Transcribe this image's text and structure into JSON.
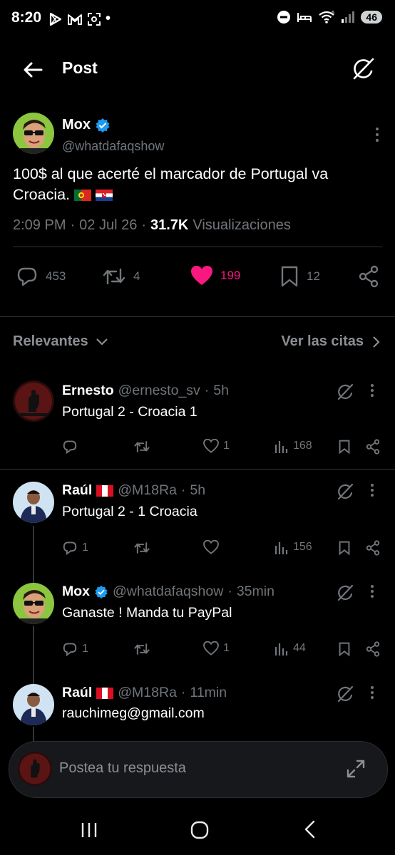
{
  "status_bar": {
    "time": "8:20",
    "battery": "46",
    "dot": "•"
  },
  "header": {
    "title": "Post"
  },
  "post": {
    "author": {
      "name": "Mox",
      "handle": "@whatdafaqshow",
      "verified": true
    },
    "text": "100$ al que acerté el marcador de Portugal va Croacia.",
    "flags": [
      "portugal-flag",
      "croatia-flag"
    ],
    "time": "2:09 PM",
    "date": "02 Jul 26",
    "views_count": "31.7K",
    "views_label": "Visualizaciones",
    "separator": "·",
    "stats": {
      "replies": "453",
      "reposts": "4",
      "likes": "199",
      "bookmarks": "12"
    }
  },
  "colors": {
    "like": "#f91880",
    "verified": "#1d9bf0",
    "muted": "#71767b",
    "background": "#000000"
  },
  "sort": {
    "label": "Relevantes",
    "quotes_label": "Ver las citas"
  },
  "replies": [
    {
      "name": "Ernesto",
      "handle": "@ernesto_sv",
      "time": "5h",
      "text": "Portugal 2 - Croacia 1",
      "replies": "",
      "likes": "1",
      "views": "168",
      "sep": "·"
    },
    {
      "name": "Raúl",
      "handle": "@M18Ra",
      "time": "5h",
      "text": "Portugal 2 - 1 Croacia",
      "replies": "1",
      "likes": "",
      "views": "156",
      "flag": "peru-flag",
      "sep": "·"
    },
    {
      "name": "Mox",
      "handle": "@whatdafaqshow",
      "time": "35min",
      "text": "Ganaste ! Manda tu PayPal",
      "replies": "1",
      "likes": "1",
      "views": "44",
      "verified": true,
      "sep": "·"
    },
    {
      "name": "Raúl",
      "handle": "@M18Ra",
      "time": "11min",
      "text": "rauchimeg@gmail.com",
      "flag": "peru-flag",
      "sep": "·"
    }
  ],
  "composer": {
    "placeholder": "Postea tu respuesta"
  }
}
